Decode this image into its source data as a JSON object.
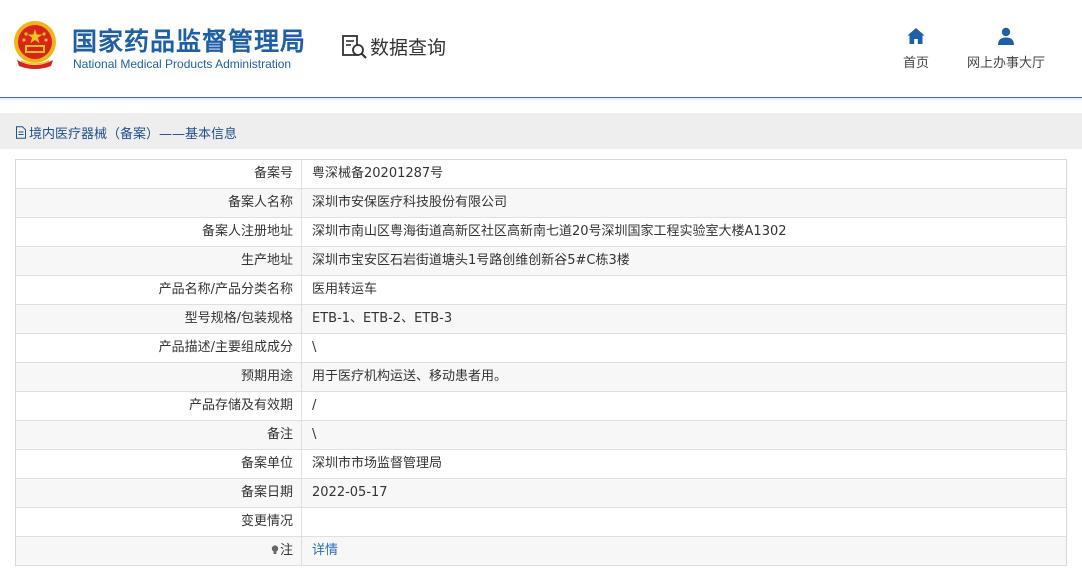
{
  "header": {
    "org_name_cn": "国家药品监督管理局",
    "org_name_en": "National Medical Products Administration",
    "data_query": "数据查询",
    "nav": {
      "home": "首页",
      "online_hall": "网上办事大厅"
    }
  },
  "section_title": "境内医疗器械（备案）——基本信息",
  "rows": [
    {
      "label": "备案号",
      "value": "粤深械备20201287号"
    },
    {
      "label": "备案人名称",
      "value": "深圳市安保医疗科技股份有限公司"
    },
    {
      "label": "备案人注册地址",
      "value": "深圳市南山区粤海街道高新区社区高新南七道20号深圳国家工程实验室大楼A1302"
    },
    {
      "label": "生产地址",
      "value": "深圳市宝安区石岩街道塘头1号路创维创新谷5#C栋3楼"
    },
    {
      "label": "产品名称/产品分类名称",
      "value": "医用转运车"
    },
    {
      "label": "型号规格/包装规格",
      "value": "ETB-1、ETB-2、ETB-3"
    },
    {
      "label": "产品描述/主要组成成分",
      "value": "\\"
    },
    {
      "label": "预期用途",
      "value": "用于医疗机构运送、移动患者用。"
    },
    {
      "label": "产品存储及有效期",
      "value": "/"
    },
    {
      "label": "备注",
      "value": "\\"
    },
    {
      "label": "备案单位",
      "value": "深圳市市场监督管理局"
    },
    {
      "label": "备案日期",
      "value": "2022-05-17"
    },
    {
      "label": "变更情况",
      "value": ""
    },
    {
      "label": "注",
      "value": "详情"
    }
  ],
  "colors": {
    "brand_blue": "#1f5fa8",
    "link_blue": "#2a6db9",
    "title_bar_bg": "#eeeeee"
  },
  "icons": [
    "national-emblem-icon",
    "data-query-icon",
    "home-icon",
    "user-icon",
    "document-icon",
    "lightbulb-icon"
  ]
}
